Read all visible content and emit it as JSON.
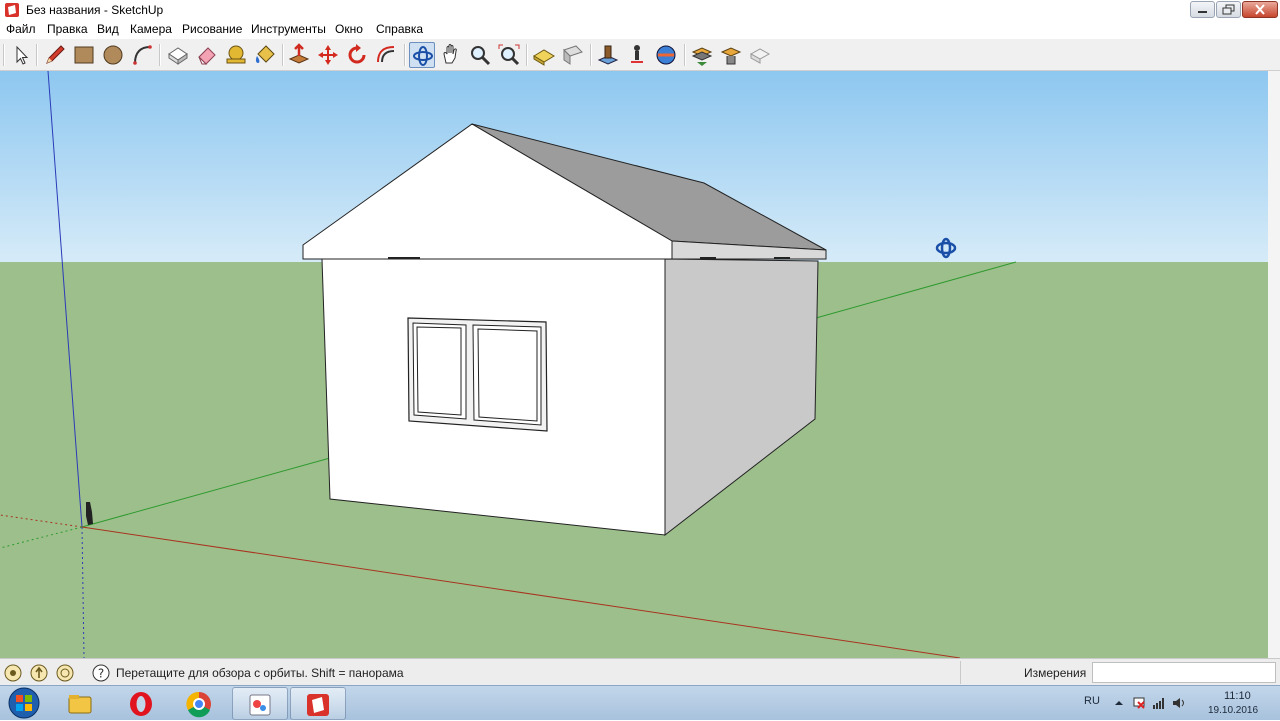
{
  "window": {
    "title": "Без названия - SketchUp",
    "app_icon": "sketchup-icon"
  },
  "menu": [
    {
      "label": "Файл"
    },
    {
      "label": "Правка"
    },
    {
      "label": "Вид"
    },
    {
      "label": "Камера"
    },
    {
      "label": "Рисование"
    },
    {
      "label": "Инструменты"
    },
    {
      "label": "Окно"
    },
    {
      "label": "Справка"
    }
  ],
  "toolbar": {
    "tools": [
      "select-icon",
      "pencil-icon",
      "rectangle-icon",
      "circle-icon",
      "arc-icon",
      "make-component-icon",
      "eraser-icon",
      "paint-bucket-icon",
      "push-pull-icon",
      "push-pull-alt-icon",
      "move-icon",
      "rotate-icon",
      "offset-icon",
      "orbit-icon",
      "pan-icon",
      "zoom-icon",
      "zoom-extents-icon",
      "sandbox-icon",
      "shapes-icon",
      "figure-icon",
      "position-camera-icon",
      "look-around-icon",
      "section-icon",
      "section-cut-icon",
      "section-fill-icon"
    ]
  },
  "viewport": {
    "sky_color": "#b4d8f3",
    "ground_color": "#9dbf8c",
    "cursor": "orbit-cursor-icon"
  },
  "status": {
    "text": "Перетащите для обзора с орбиты.  Shift = панорама",
    "measure_label": "Измерения",
    "measure_value": ""
  },
  "taskbar": {
    "apps": [
      "explorer-icon",
      "opera-icon",
      "chrome-icon",
      "paint-icon",
      "sketchup-icon"
    ],
    "language": "RU",
    "time": "11:10",
    "date": "19.10.2016"
  }
}
